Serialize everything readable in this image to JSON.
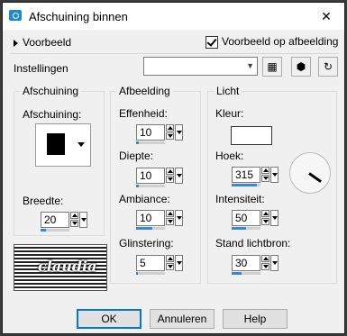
{
  "window": {
    "title": "Afschuining binnen"
  },
  "preview": {
    "toggle_label": "Voorbeeld",
    "checkbox_label": "Voorbeeld op afbeelding",
    "checked": true
  },
  "settings": {
    "label": "Instellingen",
    "value": ""
  },
  "groups": {
    "bevel": {
      "title": "Afschuining",
      "shape_label": "Afschuining:",
      "width_label": "Breedte:",
      "width_value": "20",
      "width_fraction": 0.2
    },
    "image": {
      "title": "Afbeelding",
      "fields": [
        {
          "label": "Effenheid:",
          "value": "10",
          "fraction": 0.1
        },
        {
          "label": "Diepte:",
          "value": "10",
          "fraction": 0.1
        },
        {
          "label": "Ambiance:",
          "value": "10",
          "fraction": 0.55
        },
        {
          "label": "Glinstering:",
          "value": "5",
          "fraction": 0.05
        }
      ]
    },
    "light": {
      "title": "Licht",
      "color_label": "Kleur:",
      "color_value": "#ffffff",
      "angle_label": "Hoek:",
      "angle_value": "315",
      "angle_fraction": 0.87,
      "intensity_label": "Intensiteit:",
      "intensity_value": "50",
      "intensity_fraction": 0.5,
      "elevation_label": "Stand lichtbron:",
      "elevation_value": "30",
      "elevation_fraction": 0.33
    }
  },
  "logo": {
    "text": "claudia"
  },
  "buttons": {
    "ok": "OK",
    "cancel": "Annuleren",
    "help": "Help"
  },
  "icons": {
    "title": "app-icon",
    "close": "close-icon",
    "save": "save-icon",
    "cube": "cube-icon",
    "reset": "reset-icon"
  }
}
